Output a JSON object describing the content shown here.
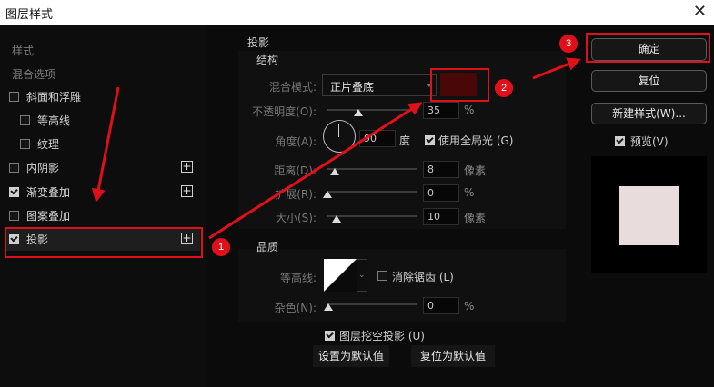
{
  "window": {
    "title": "图层样式",
    "close_glyph": "✕"
  },
  "sidebar": {
    "styles_label": "样式",
    "blend_options_label": "混合选项",
    "items": [
      {
        "label": "斜面和浮雕",
        "checked": false
      },
      {
        "label": "等高线",
        "checked": false
      },
      {
        "label": "纹理",
        "checked": false
      },
      {
        "label": "内阴影",
        "checked": false
      },
      {
        "label": "渐变叠加",
        "checked": true
      },
      {
        "label": "图案叠加",
        "checked": false
      },
      {
        "label": "投影",
        "checked": true
      }
    ]
  },
  "drop_shadow": {
    "title": "投影",
    "structure_label": "结构",
    "blend_mode_label": "混合模式:",
    "blend_mode_value": "正片叠底",
    "shadow_color": "#4a0707",
    "opacity_label": "不透明度(O):",
    "opacity_value": "35",
    "opacity_unit": "%",
    "angle_label": "角度(A):",
    "angle_value": "90",
    "angle_unit": "度",
    "global_light_label": "使用全局光 (G)",
    "distance_label": "距离(D):",
    "distance_value": "8",
    "distance_unit": "像素",
    "spread_label": "扩展(R):",
    "spread_value": "0",
    "spread_unit": "%",
    "size_label": "大小(S):",
    "size_value": "10",
    "size_unit": "像素",
    "quality_label": "品质",
    "contour_label": "等高线:",
    "anti_alias_label": "消除锯齿 (L)",
    "noise_label": "杂色(N):",
    "noise_value": "0",
    "noise_unit": "%",
    "knockout_label": "图层挖空投影 (U)",
    "make_default_label": "设置为默认值",
    "reset_default_label": "复位为默认值"
  },
  "actions": {
    "ok_label": "确定",
    "reset_label": "复位",
    "new_style_label": "新建样式(W)...",
    "preview_label": "预览(V)",
    "preview_swatch": "#e8dcdc"
  },
  "annotations": {
    "badge_1": "1",
    "badge_2": "2",
    "badge_3": "3",
    "color": "#e0101a"
  }
}
